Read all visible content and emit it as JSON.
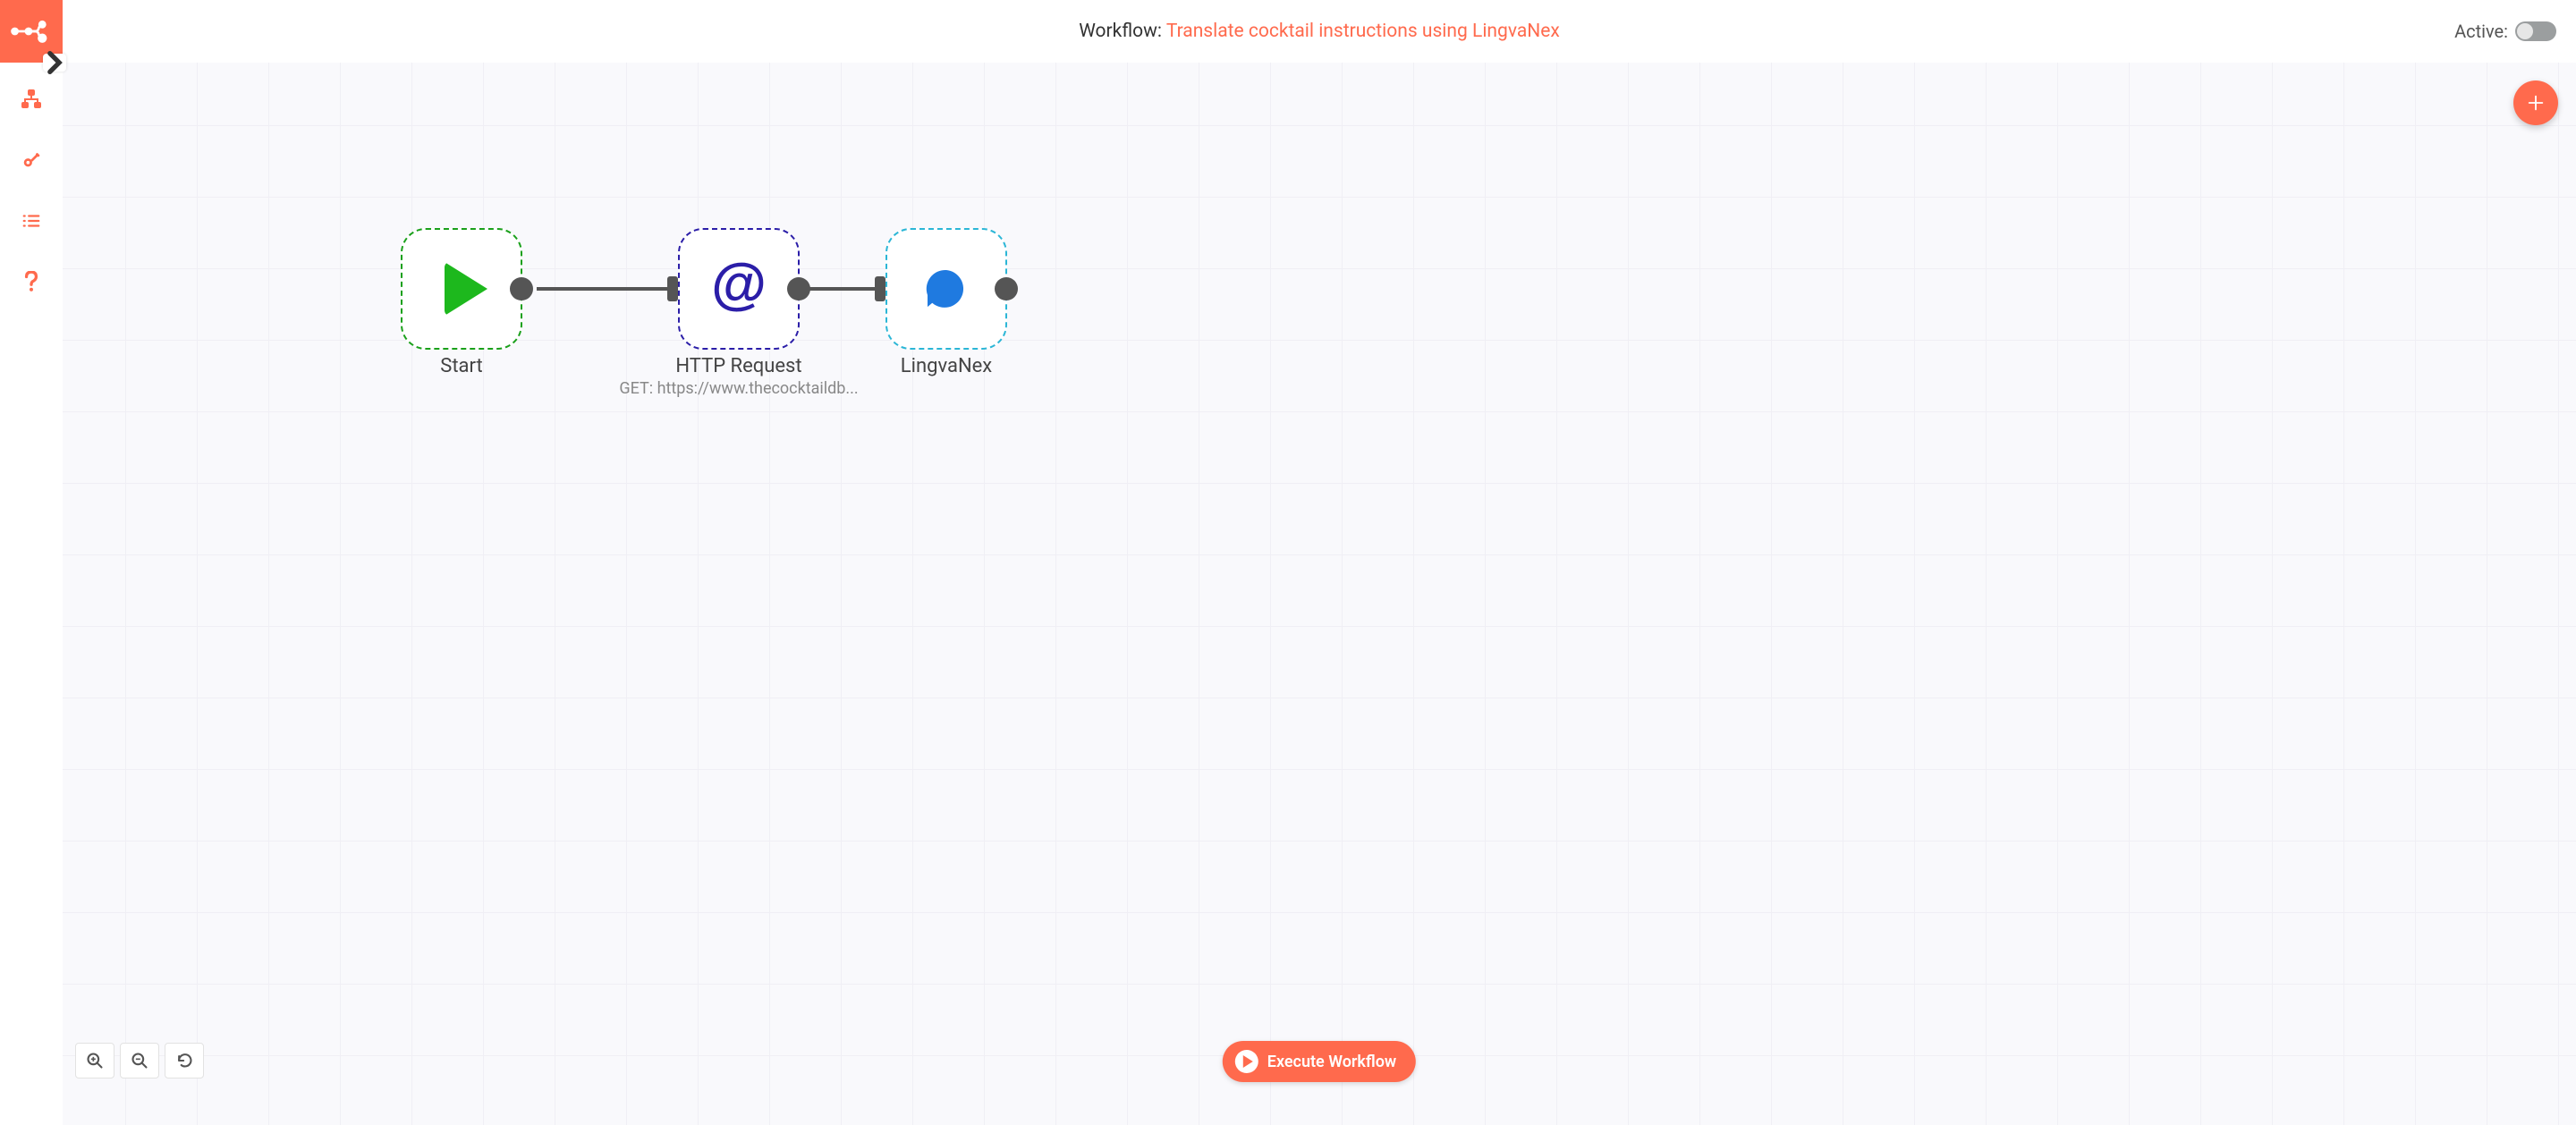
{
  "header": {
    "prefix": "Workflow: ",
    "name": "Translate cocktail instructions using LingvaNex",
    "active_label": "Active:"
  },
  "sidebar": {
    "items": [
      {
        "name": "workflows-icon"
      },
      {
        "name": "credentials-icon"
      },
      {
        "name": "executions-icon"
      },
      {
        "name": "help-icon"
      }
    ]
  },
  "nodes": {
    "start": {
      "label": "Start"
    },
    "http": {
      "label": "HTTP Request",
      "sub": "GET: https://www.thecocktaildb..."
    },
    "lingva": {
      "label": "LingvaNex"
    }
  },
  "controls": {
    "execute": "Execute Workflow"
  },
  "colors": {
    "accent": "#ff6a4d"
  }
}
